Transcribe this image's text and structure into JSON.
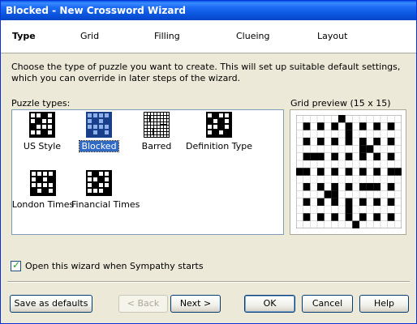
{
  "window": {
    "title": "Blocked - New Crossword Wizard"
  },
  "steps": [
    "Type",
    "Grid",
    "Filling",
    "Clueing",
    "Layout"
  ],
  "description": "Choose the type of puzzle you want to create. This will set up suitable default settings, which you can override in later steps of the wizard.",
  "puzzle_types_label": "Puzzle types:",
  "puzzle_types": [
    {
      "label": "US Style",
      "selected": false
    },
    {
      "label": "Blocked",
      "selected": true
    },
    {
      "label": "Barred",
      "selected": false
    },
    {
      "label": "Definition Type",
      "selected": false
    },
    {
      "label": "London Times",
      "selected": false
    },
    {
      "label": "Financial Times",
      "selected": false
    }
  ],
  "preview": {
    "label": "Grid preview (15 x 15)",
    "rows": [
      "000000100000000",
      "010101010101010",
      "000000010000000",
      "010101010101010",
      "000000000110000",
      "011101010101010",
      "000000000000000",
      "110101010101011",
      "000000000000000",
      "010101010111010",
      "000011000000000",
      "010101010101010",
      "000000010000000",
      "010101010101010",
      "000000001000000"
    ]
  },
  "open_on_start": {
    "label": "Open this wizard when Sympathy starts",
    "checked": true
  },
  "buttons": {
    "save_defaults": "Save as defaults",
    "back": "< Back",
    "next": "Next >",
    "ok": "OK",
    "cancel": "Cancel",
    "help": "Help"
  }
}
